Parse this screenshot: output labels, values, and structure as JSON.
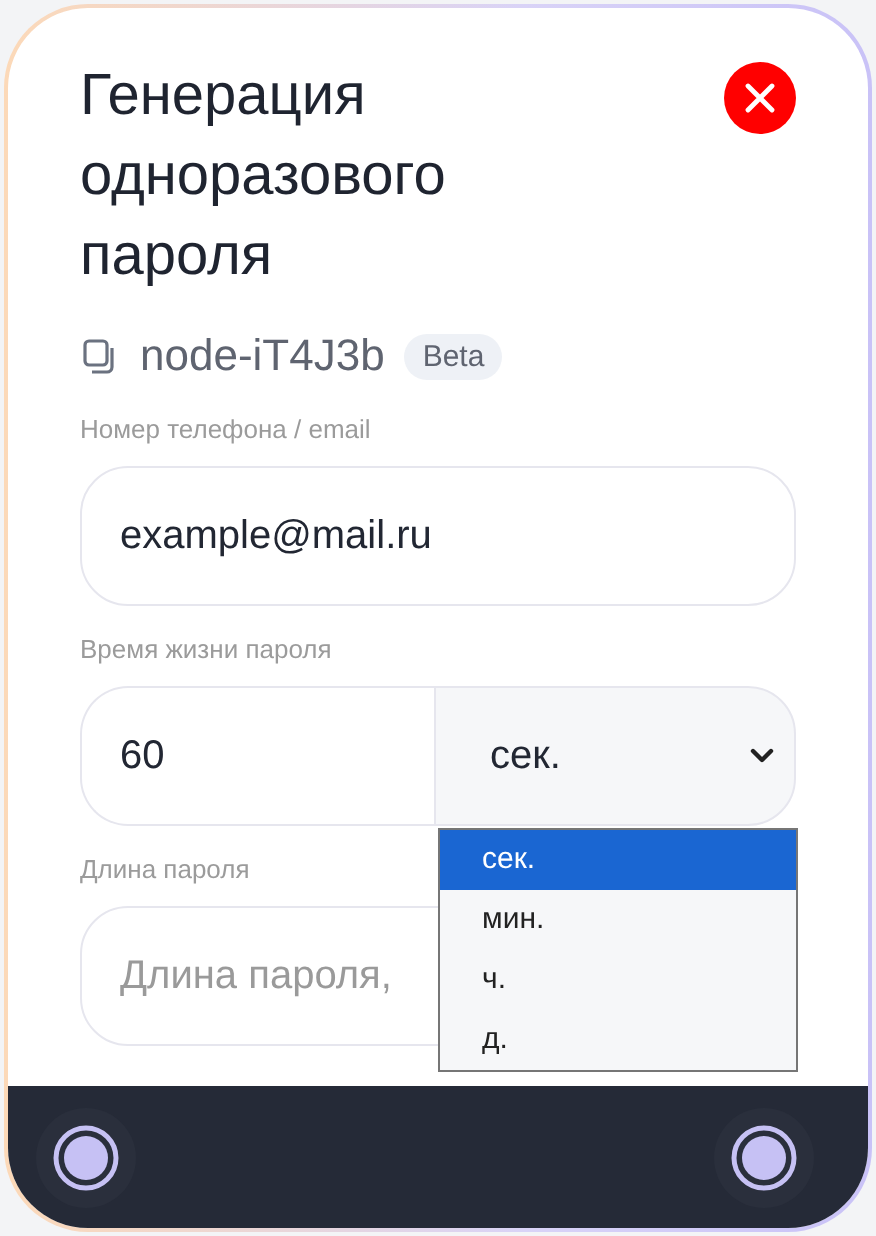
{
  "title": "Генерация одноразового пароля",
  "node": {
    "id": "node-iT4J3b",
    "badge": "Beta"
  },
  "fields": [
    {
      "kind": "text",
      "label": "Номер телефона / email",
      "value": "example@mail.ru"
    },
    {
      "kind": "number_unit",
      "label": "Время жизни пароля",
      "value": "60",
      "unit": "сек."
    },
    {
      "kind": "text",
      "label": "Длина пароля",
      "placeholder": "Длина пароля,"
    }
  ],
  "unit_options": [
    {
      "label": "сек.",
      "selected": true
    },
    {
      "label": "мин.",
      "selected": false
    },
    {
      "label": "ч.",
      "selected": false
    },
    {
      "label": "д.",
      "selected": false
    }
  ]
}
